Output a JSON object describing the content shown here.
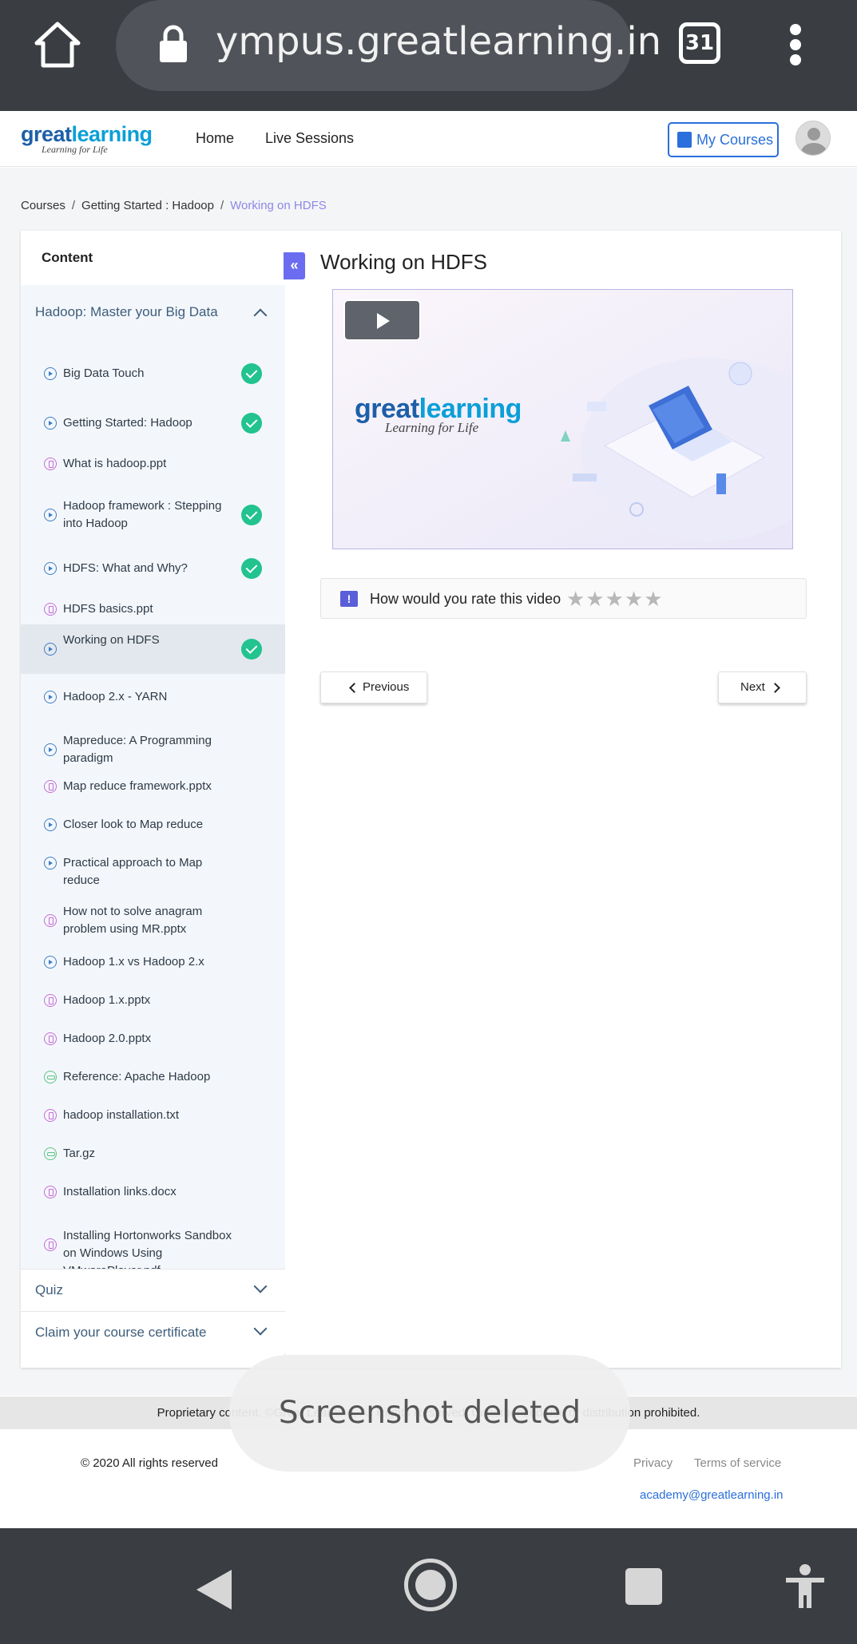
{
  "browser": {
    "url": "ympus.greatlearning.in",
    "tab_count": "31"
  },
  "header": {
    "logo_main_a": "great",
    "logo_main_b": "learning",
    "logo_tagline": "Learning for Life",
    "nav": [
      "Home",
      "Live Sessions"
    ],
    "my_courses": "My Courses"
  },
  "breadcrumb": {
    "items": [
      "Courses",
      "Getting Started : Hadoop"
    ],
    "current": "Working on HDFS"
  },
  "sidebar": {
    "title": "Content",
    "module": "Hadoop: Master your Big Data",
    "items": [
      {
        "label": "Big Data Touch",
        "type": "video",
        "done": true
      },
      {
        "label": "Getting Started: Hadoop",
        "type": "video",
        "done": true
      },
      {
        "label": "What is hadoop.ppt",
        "type": "doc",
        "done": false
      },
      {
        "label": "Hadoop framework : Stepping into Hadoop",
        "type": "video",
        "done": true
      },
      {
        "label": "HDFS: What and Why?",
        "type": "video",
        "done": true
      },
      {
        "label": "HDFS basics.ppt",
        "type": "doc",
        "done": false
      },
      {
        "label": "Working on HDFS",
        "type": "video",
        "done": true
      },
      {
        "label": "Hadoop 2.x - YARN",
        "type": "video",
        "done": false
      },
      {
        "label": "Mapreduce: A Programming paradigm",
        "type": "video",
        "done": false
      },
      {
        "label": "Map reduce framework.pptx",
        "type": "doc",
        "done": false
      },
      {
        "label": "Closer look to Map reduce",
        "type": "video",
        "done": false
      },
      {
        "label": "Practical approach to Map reduce",
        "type": "video",
        "done": false
      },
      {
        "label": "How not to solve anagram problem using MR.pptx",
        "type": "doc",
        "done": false
      },
      {
        "label": "Hadoop 1.x vs Hadoop 2.x",
        "type": "video",
        "done": false
      },
      {
        "label": "Hadoop 1.x.pptx",
        "type": "doc",
        "done": false
      },
      {
        "label": "Hadoop 2.0.pptx",
        "type": "doc",
        "done": false
      },
      {
        "label": "Reference: Apache Hadoop",
        "type": "link",
        "done": false
      },
      {
        "label": "hadoop installation.txt",
        "type": "doc",
        "done": false
      },
      {
        "label": "Tar.gz",
        "type": "link",
        "done": false
      },
      {
        "label": "Installation links.docx",
        "type": "doc",
        "done": false
      },
      {
        "label": "Installing Hortonworks Sandbox on Windows Using VMwarePlayer.pdf",
        "type": "doc",
        "done": false
      }
    ],
    "quiz": "Quiz",
    "certificate": "Claim your course certificate",
    "collapse_glyph": "«"
  },
  "main": {
    "title": "Working on HDFS",
    "rating_prompt": "How would you rate this video",
    "rating_icon": "!",
    "stars": "★★★★★",
    "prev": "Previous",
    "next": "Next"
  },
  "footer": {
    "proprietary": "Proprietary content. ©Great Learning. All Rights Reserved. Unauthorized use or distribution prohibited.",
    "copyright": "© 2020 All rights reserved",
    "privacy": "Privacy",
    "terms": "Terms of service",
    "email": "academy@greatlearning.in"
  },
  "toast": "Screenshot deleted",
  "colors": {
    "accent": "#6b6cf0",
    "done_green": "#22c38e",
    "link_blue": "#2a6fdb",
    "breadcrumb_current": "#8f86e8"
  }
}
